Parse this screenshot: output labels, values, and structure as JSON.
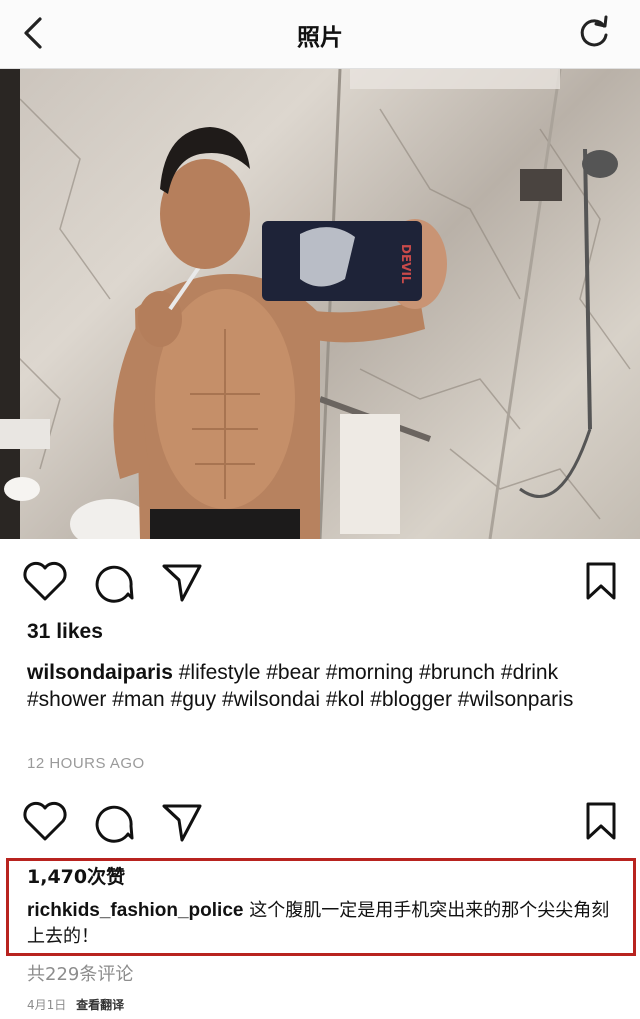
{
  "header": {
    "title": "照片"
  },
  "post": {
    "likes": "31 likes",
    "username": "wilsondaiparis",
    "caption": "#lifestyle #bear #morning #brunch #drink #shower #man #guy #wilsondai #kol #blogger #wilsonparis",
    "time": "12 HOURS AGO"
  },
  "repost": {
    "likes": "1,470次赞",
    "comment_user": "richkids_fashion_police",
    "comment_text": "这个腹肌一定是用手机突出来的那个尖尖角刻上去的！",
    "comment_count": "共229条评论",
    "date": "4月1日",
    "translate": "查看翻译"
  },
  "photo": {
    "phone_case_text": "DEVIL"
  },
  "colors": {
    "highlight_border": "#b8231f",
    "muted_text": "#9a9a9a"
  },
  "icons": [
    "back-chevron-icon",
    "refresh-icon",
    "heart-icon",
    "comment-icon",
    "share-icon",
    "bookmark-icon"
  ]
}
